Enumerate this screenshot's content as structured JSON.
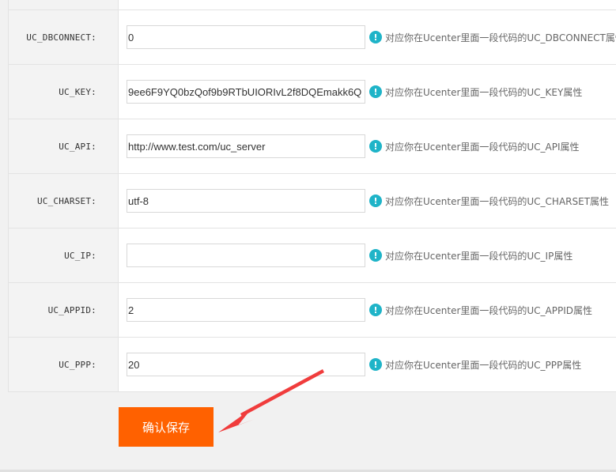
{
  "form": {
    "rows": [
      {
        "key": "dbconnect",
        "label": "UC_DBCONNECT:",
        "value": "0",
        "hint": "对应你在Ucenter里面一段代码的UC_DBCONNECT属性"
      },
      {
        "key": "key",
        "label": "UC_KEY:",
        "value": "9ee6F9YQ0bzQof9b9RTbUIORIvL2f8DQEmakk6Q",
        "hint": "对应你在Ucenter里面一段代码的UC_KEY属性"
      },
      {
        "key": "api",
        "label": "UC_API:",
        "value": "http://www.test.com/uc_server",
        "hint": "对应你在Ucenter里面一段代码的UC_API属性"
      },
      {
        "key": "charset",
        "label": "UC_CHARSET:",
        "value": "utf-8",
        "hint": "对应你在Ucenter里面一段代码的UC_CHARSET属性"
      },
      {
        "key": "ip",
        "label": "UC_IP:",
        "value": "",
        "hint": "对应你在Ucenter里面一段代码的UC_IP属性"
      },
      {
        "key": "appid",
        "label": "UC_APPID:",
        "value": "2",
        "hint": "对应你在Ucenter里面一段代码的UC_APPID属性"
      },
      {
        "key": "ppp",
        "label": "UC_PPP:",
        "value": "20",
        "hint": "对应你在Ucenter里面一段代码的UC_PPP属性"
      }
    ],
    "info_icon": "!",
    "save_label": "确认保存"
  },
  "icons": {
    "hint": "info-circle-icon",
    "annotation": "red-arrow-annotation"
  },
  "colors": {
    "accent": "#ff6100",
    "info": "#1fb4c8",
    "arrow": "#f03c3c"
  }
}
